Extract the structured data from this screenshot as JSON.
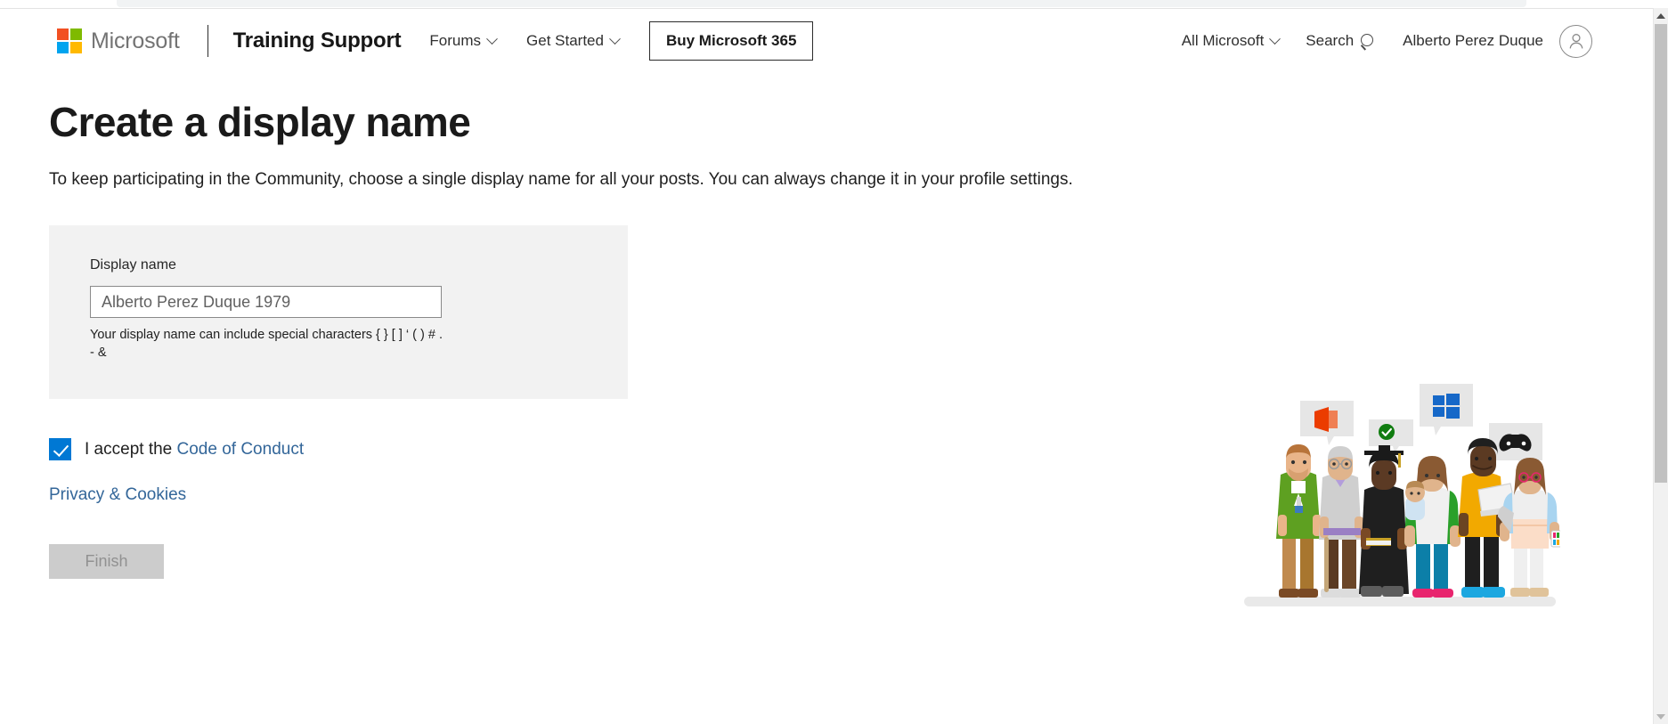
{
  "browser": {
    "scrollbar": {
      "up_arrow_icon": "triangle-up-icon",
      "down_arrow_icon": "triangle-down-icon"
    }
  },
  "header": {
    "logo": {
      "icon": "microsoft-logo-icon",
      "wordmark": "Microsoft",
      "colors": {
        "red": "#F25022",
        "green": "#7FBA00",
        "blue": "#00A4EF",
        "yellow": "#FFB900"
      }
    },
    "site_name": "Training Support",
    "nav": [
      {
        "label": "Forums",
        "has_chevron": true,
        "icon": "chevron-down-icon"
      },
      {
        "label": "Get Started",
        "has_chevron": true,
        "icon": "chevron-down-icon"
      }
    ],
    "buy_button": "Buy Microsoft 365",
    "all_microsoft": {
      "label": "All Microsoft",
      "icon": "chevron-down-icon"
    },
    "search": {
      "label": "Search",
      "icon": "search-icon"
    },
    "account": {
      "name": "Alberto Perez Duque",
      "icon": "user-avatar-icon"
    }
  },
  "main": {
    "title": "Create a display name",
    "subtitle": "To keep participating in the Community, choose a single display name for all your posts. You can always change it in your profile settings.",
    "form": {
      "field_label": "Display name",
      "field_value": "Alberto Perez Duque 1979",
      "field_placeholder": "Display name",
      "help_text": "Your display name can include special characters { } [ ] ‘ ( ) # . - &"
    },
    "accept": {
      "prefix": "I accept the",
      "link_label": "Code of Conduct",
      "checked": true,
      "checkbox_color": "#0078D4"
    },
    "privacy_link": "Privacy & Cookies",
    "finish_button": {
      "label": "Finish",
      "disabled": true
    }
  },
  "illustration": {
    "name": "community-people-illustration",
    "bubbles": [
      {
        "icon": "office-logo-icon",
        "color": "#EB3C00"
      },
      {
        "icon": "green-check-icon",
        "color": "#107C10"
      },
      {
        "icon": "windows-logo-icon",
        "color": "#0078D4"
      },
      {
        "icon": "xbox-controller-icon",
        "color": "#1A1A1A"
      }
    ],
    "people_count": 6
  }
}
